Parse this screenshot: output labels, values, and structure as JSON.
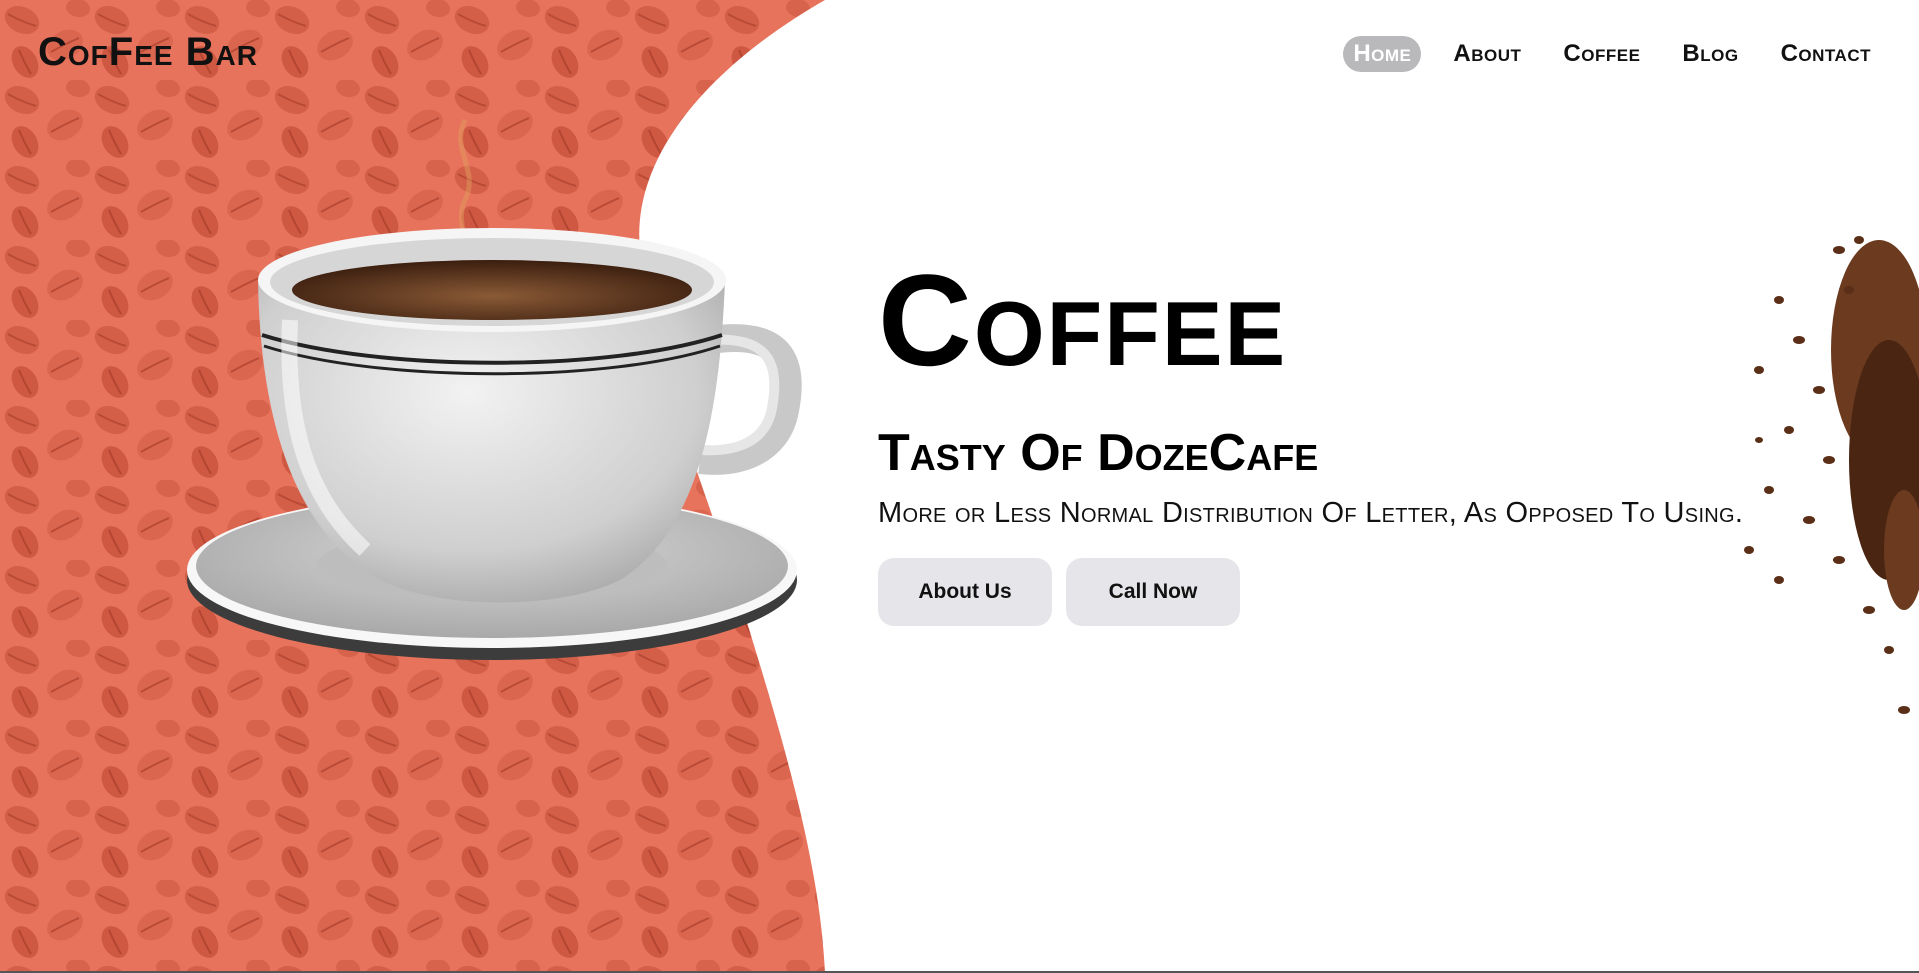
{
  "brand": {
    "logo": "CofFee Bar"
  },
  "nav": {
    "items": [
      {
        "label": "Home",
        "active": true
      },
      {
        "label": "About",
        "active": false
      },
      {
        "label": "Coffee",
        "active": false
      },
      {
        "label": "Blog",
        "active": false
      },
      {
        "label": "Contact",
        "active": false
      }
    ]
  },
  "hero": {
    "title": "Coffee",
    "subtitle": "Tasty Of DozeCafe",
    "description": "More or Less Normal Distribution Of Letter, As Opposed To Using.",
    "buttons": {
      "about": "About Us",
      "call": "Call Now"
    }
  },
  "colors": {
    "hero_background": "#e8735c",
    "bean_overlay": "#c85a45",
    "button_background": "#e6e6ea",
    "nav_active": "#b9b9bc"
  },
  "icons": {
    "cup": "coffee-cup-illustration",
    "beans": "coffee-beans-illustration"
  }
}
